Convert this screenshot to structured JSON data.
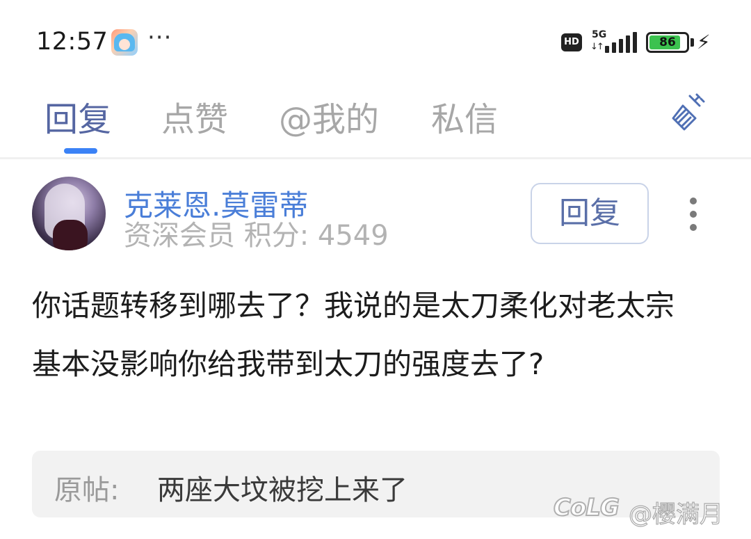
{
  "status_bar": {
    "time": "12:57",
    "more": "···",
    "hd": "HD",
    "network": "5G",
    "network_arrows": "↓↑",
    "battery_percent": 86,
    "battery_label": "86",
    "battery_color": "#3cc24f",
    "charging_icon": "⚡"
  },
  "tabs": [
    {
      "label": "回复",
      "active": true
    },
    {
      "label": "点赞",
      "active": false
    },
    {
      "label": "@我的",
      "active": false
    },
    {
      "label": "私信",
      "active": false
    }
  ],
  "accent_color": "#3b82f6",
  "clean_icon": "broom-icon",
  "reply": {
    "username": "克莱恩.莫雷蒂",
    "user_meta": "资深会员 积分: 4549",
    "reply_button_label": "回复",
    "content": "你话题转移到哪去了？我说的是太刀柔化对老太宗基本没影响你给我带到太刀的强度去了?",
    "original_post_label": "原帖:",
    "original_post_title": "两座大坟被挖上来了"
  },
  "watermark": {
    "logo": "CoLG",
    "user": "@樱满月"
  }
}
